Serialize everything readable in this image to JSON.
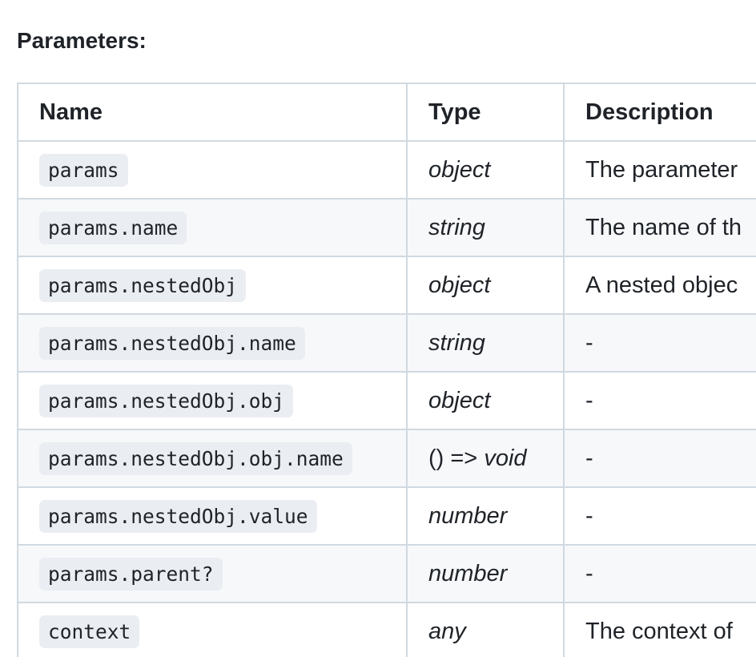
{
  "heading": "Parameters:",
  "table": {
    "headers": {
      "name": "Name",
      "type": "Type",
      "description": "Description"
    },
    "rows": [
      {
        "name": "params",
        "type": "object",
        "description": "The parameter"
      },
      {
        "name": "params.name",
        "type": "string",
        "description": "The name of th"
      },
      {
        "name": "params.nestedObj",
        "type": "object",
        "description": "A nested objec"
      },
      {
        "name": "params.nestedObj.name",
        "type": "string",
        "description": "-"
      },
      {
        "name": "params.nestedObj.obj",
        "type": "object",
        "description": "-"
      },
      {
        "name": "params.nestedObj.obj.name",
        "type_prefix": "() => ",
        "type": "void",
        "description": "-"
      },
      {
        "name": "params.nestedObj.value",
        "type": "number",
        "description": "-"
      },
      {
        "name": "params.parent?",
        "type": "number",
        "description": "-"
      },
      {
        "name": "context",
        "type": "any",
        "description": "The context of"
      }
    ]
  }
}
